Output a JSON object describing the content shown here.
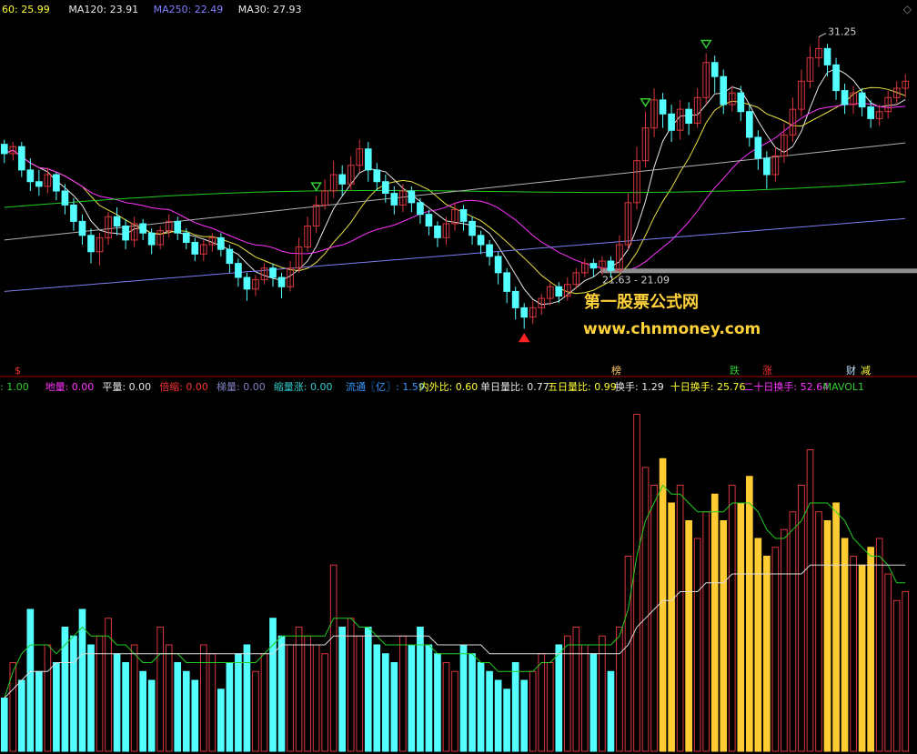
{
  "colors": {
    "up": "#d9363e",
    "down": "#54ffff",
    "ma_white": "#e6e6e6",
    "ma_yellow": "#e8e040",
    "ma_magenta": "#ff33ff",
    "ma_green": "#22cc22",
    "ma_grey": "#b0b0b0",
    "ma_purple": "#7d7df0",
    "divider": "#a80000",
    "support": "#909090",
    "watermark": "#ffd23a"
  },
  "top_legend": [
    {
      "text": "60: 25.99",
      "color": "#ffff33"
    },
    {
      "text": "MA120: 23.91",
      "color": "#e8e8e8"
    },
    {
      "text": "MA250: 22.49",
      "color": "#8080ff"
    },
    {
      "text": "MA30: 27.93",
      "color": "#e8e8e8"
    }
  ],
  "bottom_legend_left": [
    {
      "text": ": 1.00",
      "color": "#33cc33"
    },
    {
      "text": "地量: 0.00",
      "color": "#ff33ff"
    },
    {
      "text": "平量: 0.00",
      "color": "#e8e8e8"
    },
    {
      "text": "倍缩: 0.00",
      "color": "#ff3333"
    },
    {
      "text": "梯量: 0.00",
      "color": "#8080c0"
    },
    {
      "text": "缩量涨: 0.00",
      "color": "#33cccc"
    }
  ],
  "bottom_legend_right": [
    {
      "text": "流通〖亿〗: 1.59",
      "color": "#3399ff"
    },
    {
      "text": "内外比: 0.60",
      "color": "#ffff33"
    },
    {
      "text": "单日量比: 0.77",
      "color": "#e8e8e8"
    },
    {
      "text": "五日量比: 0.99",
      "color": "#ffff33"
    },
    {
      "text": "换手: 1.29",
      "color": "#e8e8e8"
    },
    {
      "text": "十日换手: 25.76",
      "color": "#ffff33"
    },
    {
      "text": "二十日换手: 52.64",
      "color": "#ff33ff"
    },
    {
      "text": "MAVOL1",
      "color": "#33cc33"
    }
  ],
  "event_markers": [
    {
      "text": "$",
      "color": "#ff3333"
    },
    {
      "text": "榜",
      "color": "#ffcc66"
    },
    {
      "text": "跌",
      "color": "#33cc33"
    },
    {
      "text": "涨",
      "color": "#ff3333"
    },
    {
      "text": "财",
      "color": "#bfe0ff"
    },
    {
      "text": "减",
      "color": "#ffff33"
    }
  ],
  "corner_icon": "diamond-icon",
  "watermark": {
    "title": "第一股票公式网",
    "url": "www.chnmoney.com"
  },
  "chart_data": [
    {
      "type": "candlestick",
      "price_range": [
        17.5,
        32.3
      ],
      "annotations": {
        "high_label": "31.25",
        "support_label": "21.63 - 21.09"
      },
      "candles": [
        [
          26.9,
          26.5,
          27.1,
          26.1
        ],
        [
          26.5,
          26.8,
          27.0,
          26.2
        ],
        [
          26.8,
          25.8,
          27.0,
          25.5
        ],
        [
          25.8,
          25.3,
          26.3,
          24.9
        ],
        [
          25.3,
          25.1,
          25.8,
          24.7
        ],
        [
          25.1,
          25.6,
          25.9,
          24.8
        ],
        [
          25.6,
          24.9,
          25.7,
          24.5
        ],
        [
          24.9,
          24.3,
          25.2,
          23.9
        ],
        [
          24.3,
          23.6,
          24.6,
          23.2
        ],
        [
          23.6,
          23.0,
          23.9,
          22.6
        ],
        [
          23.0,
          22.3,
          23.3,
          21.8
        ],
        [
          22.3,
          22.9,
          23.1,
          21.7
        ],
        [
          22.9,
          23.8,
          24.0,
          22.6
        ],
        [
          23.8,
          23.4,
          24.2,
          23.0
        ],
        [
          23.4,
          22.8,
          23.7,
          22.4
        ],
        [
          22.8,
          23.5,
          23.8,
          22.5
        ],
        [
          23.5,
          23.1,
          23.7,
          22.8
        ],
        [
          23.1,
          22.6,
          23.3,
          22.2
        ],
        [
          22.6,
          23.2,
          23.4,
          22.4
        ],
        [
          23.2,
          23.6,
          23.9,
          22.9
        ],
        [
          23.6,
          23.1,
          23.8,
          22.8
        ],
        [
          23.1,
          22.7,
          23.3,
          22.4
        ],
        [
          22.7,
          22.2,
          22.9,
          21.9
        ],
        [
          22.2,
          22.6,
          22.8,
          21.9
        ],
        [
          22.6,
          22.9,
          23.1,
          22.3
        ],
        [
          22.9,
          22.4,
          23.1,
          22.1
        ],
        [
          22.4,
          21.8,
          22.6,
          21.4
        ],
        [
          21.8,
          21.2,
          22.0,
          20.8
        ],
        [
          21.2,
          20.7,
          21.4,
          20.2
        ],
        [
          20.7,
          21.1,
          21.3,
          20.4
        ],
        [
          21.1,
          21.6,
          21.8,
          20.9
        ],
        [
          21.6,
          21.2,
          21.8,
          20.8
        ],
        [
          21.2,
          20.8,
          21.4,
          20.3
        ],
        [
          20.8,
          21.6,
          21.9,
          20.6
        ],
        [
          21.6,
          22.5,
          22.9,
          21.4
        ],
        [
          22.5,
          23.4,
          23.8,
          22.3
        ],
        [
          23.4,
          24.3,
          24.7,
          23.1
        ],
        [
          24.3,
          24.9,
          25.4,
          24.1
        ],
        [
          24.9,
          25.6,
          26.2,
          24.6
        ],
        [
          25.6,
          25.2,
          26.0,
          24.7
        ],
        [
          25.2,
          26.0,
          26.4,
          24.9
        ],
        [
          26.0,
          26.7,
          27.1,
          25.7
        ],
        [
          26.7,
          25.8,
          27.0,
          25.3
        ],
        [
          25.8,
          25.3,
          26.1,
          24.9
        ],
        [
          25.3,
          24.8,
          25.6,
          24.4
        ],
        [
          24.8,
          24.3,
          25.1,
          23.9
        ],
        [
          24.3,
          24.9,
          25.2,
          24.0
        ],
        [
          24.9,
          24.4,
          25.1,
          24.0
        ],
        [
          24.4,
          23.9,
          24.6,
          23.5
        ],
        [
          23.9,
          23.4,
          24.1,
          23.0
        ],
        [
          23.4,
          22.9,
          23.6,
          22.5
        ],
        [
          22.9,
          23.5,
          23.8,
          22.6
        ],
        [
          23.5,
          24.1,
          24.4,
          23.2
        ],
        [
          24.1,
          23.6,
          24.3,
          23.2
        ],
        [
          23.6,
          23.0,
          23.8,
          22.6
        ],
        [
          23.0,
          22.6,
          23.2,
          22.2
        ],
        [
          22.6,
          22.1,
          22.8,
          21.7
        ],
        [
          22.1,
          21.4,
          22.3,
          20.9
        ],
        [
          21.4,
          20.6,
          21.6,
          20.1
        ],
        [
          20.6,
          19.9,
          20.8,
          19.4
        ],
        [
          19.9,
          19.5,
          20.1,
          19.0
        ],
        [
          19.5,
          19.9,
          20.2,
          19.2
        ],
        [
          19.9,
          20.3,
          20.5,
          19.6
        ],
        [
          20.3,
          20.8,
          21.0,
          20.0
        ],
        [
          20.8,
          20.4,
          21.0,
          20.1
        ],
        [
          20.4,
          20.9,
          21.2,
          20.2
        ],
        [
          20.9,
          21.4,
          21.6,
          20.7
        ],
        [
          21.4,
          21.8,
          22.0,
          21.2
        ],
        [
          21.8,
          21.6,
          22.0,
          21.2
        ],
        [
          21.6,
          21.9,
          22.1,
          21.3
        ],
        [
          21.9,
          21.5,
          22.1,
          21.2
        ],
        [
          21.5,
          22.6,
          23.0,
          21.4
        ],
        [
          22.6,
          24.4,
          24.8,
          22.4
        ],
        [
          24.4,
          26.2,
          26.8,
          24.1
        ],
        [
          26.2,
          27.6,
          28.3,
          25.9
        ],
        [
          27.6,
          28.8,
          29.3,
          27.2
        ],
        [
          28.8,
          28.2,
          29.1,
          27.6
        ],
        [
          28.2,
          27.5,
          28.6,
          27.0
        ],
        [
          27.5,
          28.4,
          28.8,
          27.1
        ],
        [
          28.4,
          27.8,
          28.7,
          27.3
        ],
        [
          27.8,
          28.9,
          29.3,
          27.6
        ],
        [
          28.9,
          30.4,
          30.8,
          28.6
        ],
        [
          30.4,
          29.8,
          30.7,
          29.1
        ],
        [
          29.8,
          28.6,
          30.1,
          28.2
        ],
        [
          28.6,
          29.1,
          29.4,
          28.3
        ],
        [
          29.1,
          28.3,
          29.4,
          27.9
        ],
        [
          28.3,
          27.2,
          28.6,
          26.8
        ],
        [
          27.2,
          26.3,
          27.5,
          25.8
        ],
        [
          26.3,
          25.6,
          26.6,
          25.0
        ],
        [
          25.6,
          26.4,
          26.8,
          25.3
        ],
        [
          26.4,
          27.3,
          27.8,
          26.1
        ],
        [
          27.3,
          28.4,
          28.9,
          27.0
        ],
        [
          28.4,
          29.6,
          30.1,
          28.1
        ],
        [
          29.6,
          30.6,
          31.1,
          29.3
        ],
        [
          30.6,
          31.0,
          31.5,
          30.2
        ],
        [
          31.0,
          30.3,
          31.2,
          29.8
        ],
        [
          30.3,
          29.2,
          30.6,
          28.8
        ],
        [
          29.2,
          28.6,
          29.5,
          28.2
        ],
        [
          28.6,
          29.1,
          29.4,
          28.2
        ],
        [
          29.1,
          28.5,
          29.3,
          28.1
        ],
        [
          28.5,
          28.0,
          28.8,
          27.6
        ],
        [
          28.0,
          28.3,
          28.6,
          27.7
        ],
        [
          28.3,
          28.9,
          29.2,
          28.0
        ],
        [
          28.9,
          29.3,
          29.6,
          28.6
        ],
        [
          29.3,
          29.6,
          29.9,
          28.9
        ]
      ],
      "moving_averages": [
        {
          "name": "MA120",
          "value": 23.91
        },
        {
          "name": "MA250",
          "value": 22.49
        },
        {
          "name": "MA30",
          "value": 27.93
        }
      ]
    },
    {
      "type": "bar",
      "y_range": [
        0,
        40
      ],
      "values": [
        6,
        10,
        8,
        16,
        9,
        12,
        10,
        14,
        13,
        16,
        12,
        13,
        15,
        11,
        10,
        12,
        9,
        8,
        14,
        12,
        10,
        9,
        8,
        12,
        11,
        7,
        10,
        11,
        12,
        9,
        11,
        15,
        13,
        12,
        14,
        13,
        12,
        11,
        21,
        14,
        15,
        13,
        14,
        12,
        11,
        10,
        13,
        12,
        14,
        12,
        11,
        10,
        9,
        12,
        11,
        10,
        9,
        8,
        7,
        10,
        8,
        9,
        11,
        10,
        12,
        13,
        14,
        12,
        11,
        13,
        9,
        14,
        22,
        38,
        32,
        30,
        33,
        28,
        30,
        26,
        24,
        27,
        29,
        26,
        30,
        28,
        31,
        24,
        22,
        23,
        25,
        27,
        30,
        34,
        27,
        26,
        28,
        24,
        22,
        21,
        23,
        24,
        20,
        17,
        18
      ],
      "ma_white": [
        6,
        7,
        8,
        9,
        9,
        9,
        10,
        10,
        10,
        11,
        11,
        11,
        11,
        11,
        11,
        11,
        11,
        11,
        11,
        11,
        11,
        11,
        11,
        11,
        11,
        11,
        11,
        11,
        11,
        11,
        11,
        11,
        12,
        12,
        12,
        12,
        12,
        12,
        13,
        13,
        13,
        13,
        13,
        13,
        13,
        13,
        13,
        13,
        13,
        13,
        12,
        12,
        12,
        12,
        12,
        12,
        11,
        11,
        11,
        11,
        11,
        11,
        11,
        11,
        11,
        11,
        11,
        11,
        11,
        11,
        11,
        11,
        12,
        14,
        15,
        16,
        17,
        17,
        18,
        18,
        18,
        19,
        19,
        19,
        20,
        20,
        20,
        20,
        20,
        20,
        20,
        20,
        20,
        21,
        21,
        21,
        21,
        21,
        21,
        21,
        21,
        21,
        21,
        21,
        21
      ],
      "ma_green": [
        6,
        9,
        11,
        12,
        12,
        12,
        11,
        12,
        13,
        14,
        13,
        13,
        13,
        12,
        12,
        11,
        10,
        10,
        11,
        11,
        11,
        10,
        10,
        10,
        10,
        10,
        10,
        10,
        10,
        10,
        11,
        12,
        13,
        13,
        13,
        13,
        13,
        13,
        15,
        15,
        15,
        14,
        14,
        13,
        12,
        12,
        12,
        12,
        12,
        12,
        11,
        11,
        11,
        11,
        11,
        10,
        10,
        9,
        9,
        9,
        9,
        9,
        10,
        10,
        11,
        12,
        12,
        12,
        12,
        12,
        12,
        13,
        16,
        22,
        26,
        28,
        30,
        29,
        29,
        28,
        27,
        27,
        27,
        27,
        28,
        28,
        28,
        27,
        25,
        24,
        24,
        25,
        26,
        28,
        28,
        28,
        27,
        26,
        24,
        23,
        22,
        22,
        21,
        19,
        19
      ]
    }
  ]
}
